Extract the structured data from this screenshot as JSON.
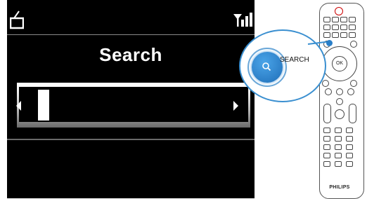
{
  "screen": {
    "title": "Search",
    "status_icons": [
      "radio-icon",
      "signal-strength-icon"
    ],
    "search_progress": 0.1
  },
  "remote": {
    "brand": "PHILIPS",
    "callout_label": "SEARCH",
    "ok_label": "OK",
    "search_button_icon": "magnifier-icon"
  },
  "colors": {
    "screen_bg": "#000000",
    "text": "#ffffff",
    "accent_blue": "#2a7fc8"
  }
}
